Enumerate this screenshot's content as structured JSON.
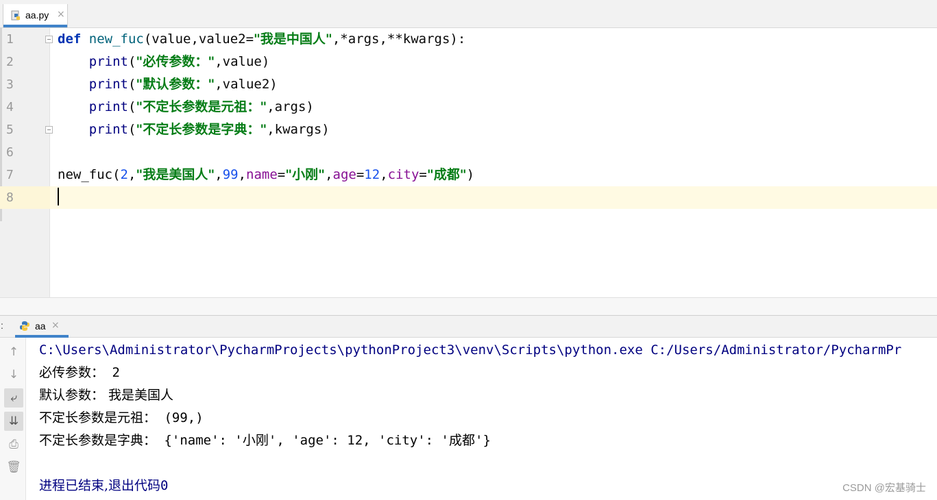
{
  "editor_tab": {
    "label": "aa.py",
    "close": "×",
    "icon": "python-file-icon"
  },
  "line_numbers": [
    "1",
    "2",
    "3",
    "4",
    "5",
    "6",
    "7",
    "8"
  ],
  "code": {
    "l1": {
      "def": "def",
      "fn": "new_fuc",
      "open": "(value,value2=",
      "str": "\"我是中国人\"",
      "rest": ",*args,**kwargs):"
    },
    "l2": {
      "print": "print",
      "open": "(",
      "str": "\"必传参数：\"",
      "rest": ",value)"
    },
    "l3": {
      "print": "print",
      "open": "(",
      "str": "\"默认参数：\"",
      "rest": ",value2)"
    },
    "l4": {
      "print": "print",
      "open": "(",
      "str": "\"不定长参数是元祖：\"",
      "rest": ",args)"
    },
    "l5": {
      "print": "print",
      "open": "(",
      "str": "\"不定长参数是字典：\"",
      "rest": ",kwargs)"
    },
    "l7": {
      "call": "new_fuc(",
      "n1": "2",
      "c1": ",",
      "s1": "\"我是美国人\"",
      "c2": ",",
      "n2": "99",
      "c3": ",",
      "p1": "name",
      "eq1": "=",
      "s2": "\"小刚\"",
      "c4": ",",
      "p2": "age",
      "eq2": "=",
      "n3": "12",
      "c5": ",",
      "p3": "city",
      "eq3": "=",
      "s3": "\"成都\"",
      "close": ")"
    }
  },
  "run_panel": {
    "prefix": ":",
    "tab_label": "aa",
    "close": "×"
  },
  "toolbar": {
    "up": "↑",
    "down": "↓",
    "wrap": "⤶",
    "scroll_end": "⇊",
    "print": "⎙",
    "trash": "🗑"
  },
  "console": {
    "command": "C:\\Users\\Administrator\\PycharmProjects\\pythonProject3\\venv\\Scripts\\python.exe C:/Users/Administrator/PycharmPr",
    "o1_label": "必传参数：",
    "o1_value": " 2",
    "o2_label": "默认参数：",
    "o2_value": " 我是美国人",
    "o3_label": "不定长参数是元祖：",
    "o3_value": " (99,)",
    "o4_label": "不定长参数是字典：",
    "o4_a": " {'name': '",
    "o4_b": "小刚",
    "o4_c": "', 'age': 12, 'city': '",
    "o4_d": "成都",
    "o4_e": "'}",
    "exit_label": "进程已结束,退出代码",
    "exit_code": "0"
  },
  "watermark": "CSDN @宏基骑士"
}
